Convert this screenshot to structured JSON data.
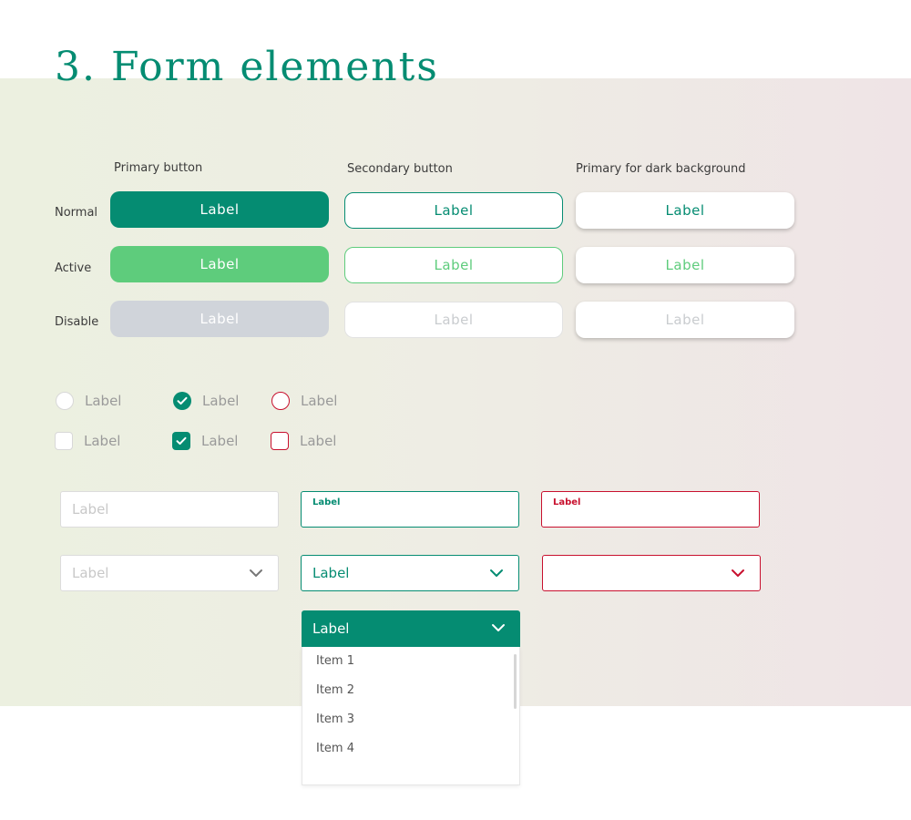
{
  "page_title": "3. Form elements",
  "colors": {
    "primary": "#058c72",
    "active": "#5ecc7c",
    "disabled": "#d0d4da",
    "error": "#c8102e"
  },
  "buttons": {
    "columns": [
      "Primary button",
      "Secondary button",
      "Primary for dark background"
    ],
    "rows": [
      "Normal",
      "Active",
      "Disable"
    ],
    "label": "Label"
  },
  "choices": {
    "radio_label": "Label",
    "checkbox_label": "Label"
  },
  "inputs": {
    "default_placeholder": "Label",
    "focus_float_label": "Label",
    "error_float_label": "Label"
  },
  "selects": {
    "default_placeholder": "Label",
    "focus_value": "Label",
    "open_value": "Label",
    "icons": [
      "chevron-down-icon"
    ]
  },
  "dropdown": {
    "items": [
      "Item 1",
      "Item 2",
      "Item 3",
      "Item 4"
    ]
  }
}
